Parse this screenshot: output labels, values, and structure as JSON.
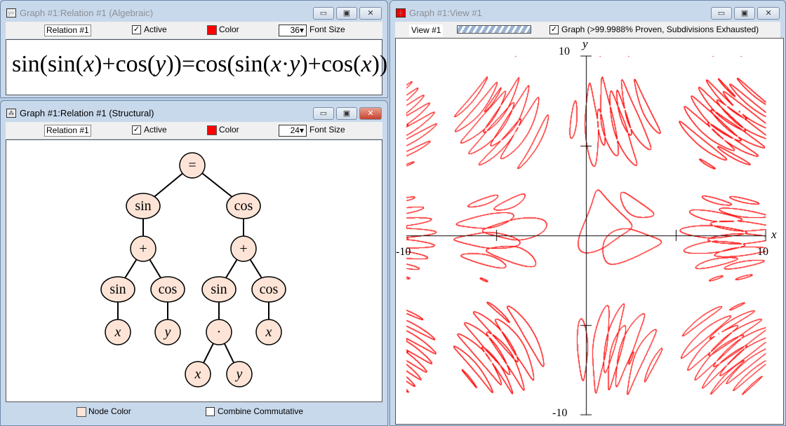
{
  "algebraic": {
    "title": "Graph #1:Relation #1 (Algebraic)",
    "relation": "Relation #1",
    "active_label": "Active",
    "color_label": "Color",
    "font_size": "36",
    "font_size_label": "Font Size",
    "formula": {
      "a": "sin(sin(",
      "x1": "x",
      "b": ")+cos(",
      "y1": "y",
      "c": "))=cos(sin(",
      "x2": "x",
      "d": "·",
      "y2": "y",
      "e": ")+cos(",
      "x3": "x",
      "f": "))"
    }
  },
  "structural": {
    "title": "Graph #1:Relation #1 (Structural)",
    "relation": "Relation #1",
    "active_label": "Active",
    "color_label": "Color",
    "font_size": "24",
    "font_size_label": "Font Size",
    "node_color_label": "Node Color",
    "combine_label": "Combine Commutative",
    "nodes": [
      "=",
      "sin",
      "cos",
      "+",
      "+",
      "sin",
      "cos",
      "sin",
      "cos",
      "x",
      "y",
      "·",
      "x",
      "x",
      "y"
    ]
  },
  "view": {
    "title": "Graph #1:View #1",
    "view_name": "View #1",
    "graph_label": "Graph (>99.9988% Proven, Subdivisions Exhausted)",
    "xlabel": "x",
    "ylabel": "y",
    "xmin_label": "-10",
    "xmax_label": "10",
    "ymax_label": "10",
    "ymin_label": "-10",
    "relation": "sin(sin(x)+cos(y))=cos(sin(x*y)+cos(x))",
    "range": [
      -10,
      10
    ],
    "curve_color": "#ff0000"
  },
  "colors": {
    "relation": "#ff0000",
    "node": "#fde4d6"
  }
}
